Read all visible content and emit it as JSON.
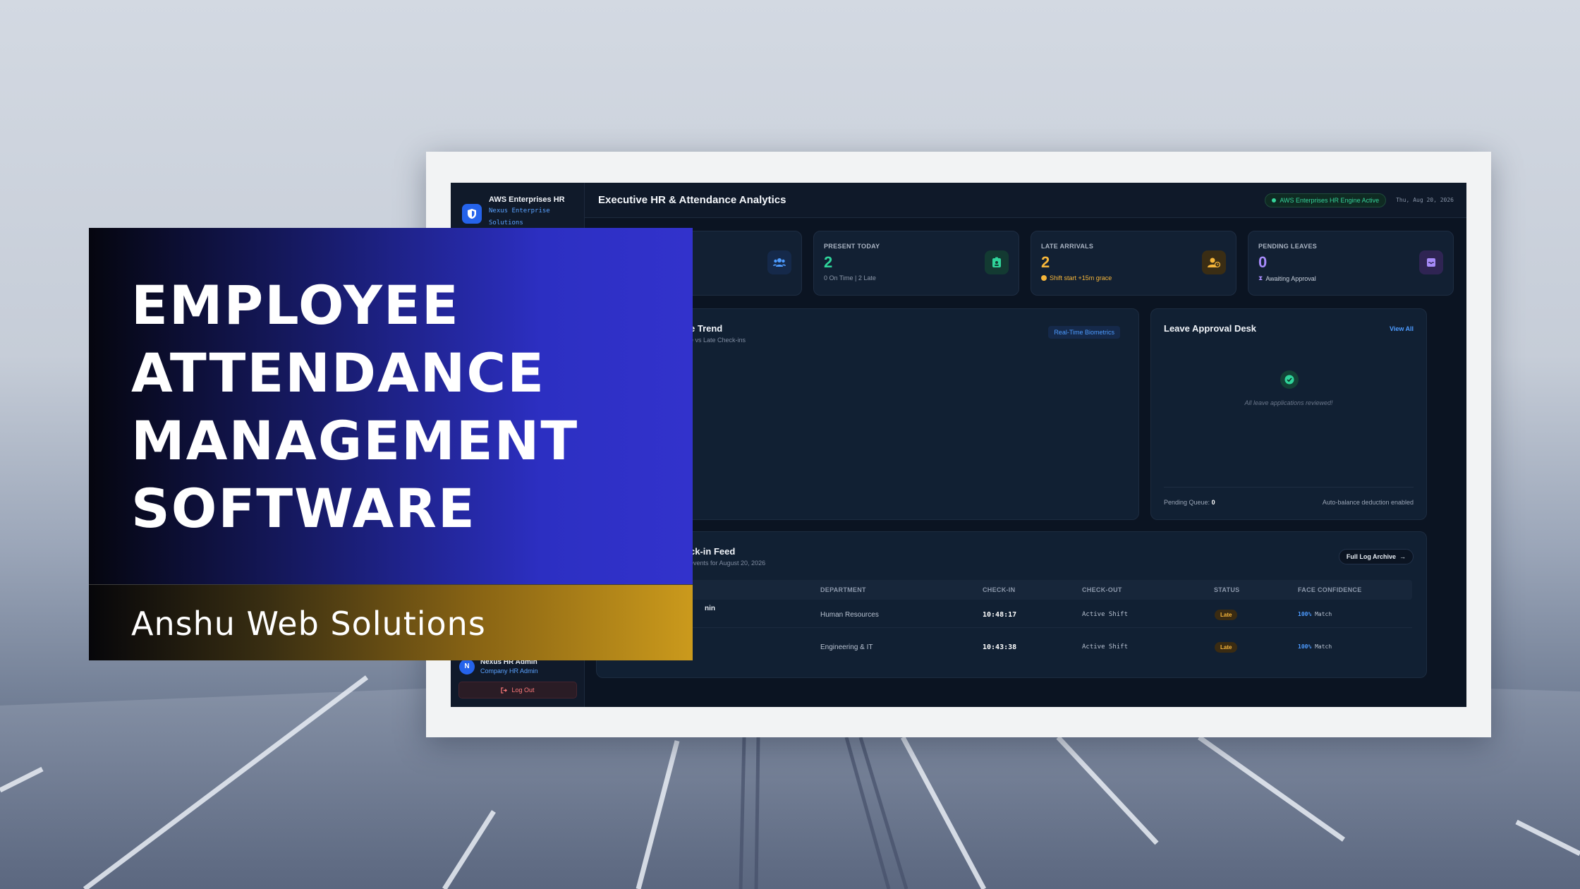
{
  "app": {
    "brand_title": "AWS Enterprises HR",
    "brand_sub_1": "Nexus Enterprise",
    "brand_sub_2": "Solutions",
    "page_title": "Executive HR & Attendance Analytics",
    "engine_status": "AWS Enterprises HR Engine Active",
    "date": "Thu, Aug 20, 2026",
    "user_name": "Nexus HR Admin",
    "user_role": "Company HR Admin",
    "user_initial": "N",
    "logout_label": "Log Out"
  },
  "stats": [
    {
      "label": "PRESENT TODAY",
      "value": "2",
      "sub": "0 On Time | 2 Late",
      "color": "#2fd39a"
    },
    {
      "label": "LATE ARRIVALS",
      "value": "2",
      "sub": "Shift start +15m grace",
      "color": "#f5b53a"
    },
    {
      "label": "PENDING LEAVES",
      "value": "0",
      "sub": "Awaiting Approval",
      "color": "#a78bfa"
    }
  ],
  "trend_panel": {
    "title": "e Trend",
    "subtitle": "e vs Late Check-ins",
    "chip": "Real-Time Biometrics"
  },
  "leave_panel": {
    "title": "Leave Approval Desk",
    "view_all": "View All",
    "empty_text": "All leave applications reviewed!",
    "queue_label": "Pending Queue:",
    "queue_value": "0",
    "auto_note": "Auto-balance deduction enabled"
  },
  "feed_panel": {
    "title": "ck-in Feed",
    "subtitle": "events for August 20, 2026",
    "archive_button": "Full Log Archive",
    "columns": [
      "DEPARTMENT",
      "CHECK-IN",
      "CHECK-OUT",
      "STATUS",
      "FACE CONFIDENCE"
    ],
    "rows": [
      {
        "name": "nin",
        "department": "Human Resources",
        "check_in": "10:48:17",
        "check_out": "Active Shift",
        "status": "Late",
        "confidence": "100%",
        "match": "Match"
      },
      {
        "name": "",
        "department": "Engineering & IT",
        "check_in": "10:43:38",
        "check_out": "Active Shift",
        "status": "Late",
        "confidence": "100%",
        "match": "Match"
      }
    ]
  },
  "overlay": {
    "title_lines": [
      "EMPLOYEE",
      "ATTENDANCE",
      "MANAGEMENT",
      "SOFTWARE"
    ],
    "brand": "Anshu Web Solutions"
  },
  "colors": {
    "accent_blue": "#4d9bff",
    "success_green": "#2fd39a",
    "warning_amber": "#f5b53a",
    "violet": "#a78bfa"
  }
}
